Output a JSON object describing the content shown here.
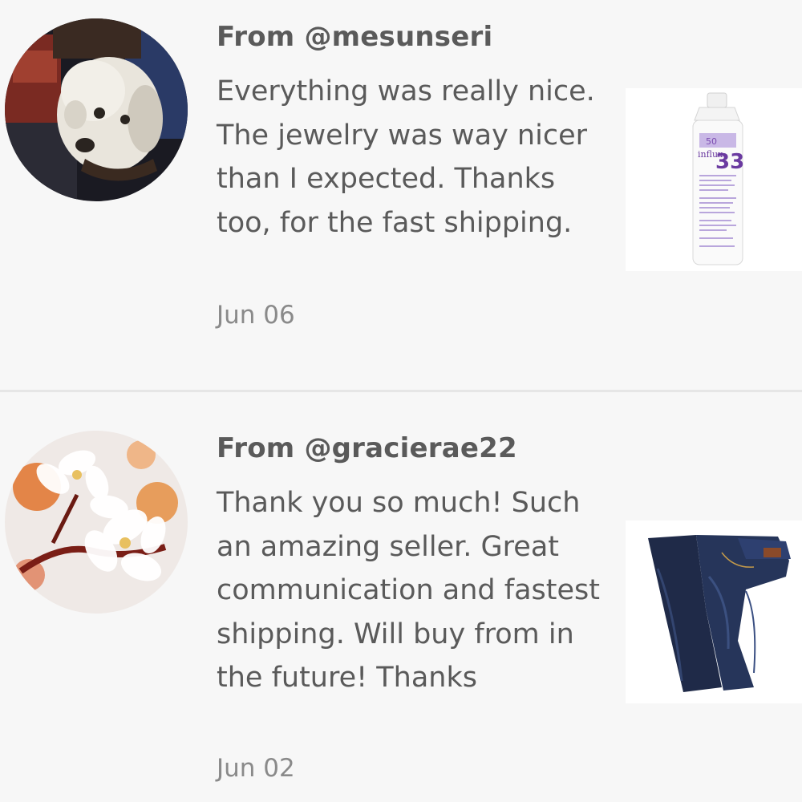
{
  "reviews": [
    {
      "from": "From @mesunseri",
      "comment": "Everything was really nice. The jewelry was way nicer than I expected. Thanks too, for the fast shipping.",
      "date": "Jun 06",
      "avatar_icon": "dog-photo",
      "product_icon": "conditioner-bottle-photo",
      "product_label": {
        "badge": "50",
        "brand": "influx",
        "number": "33"
      }
    },
    {
      "from": "From @gracierae22",
      "comment": "Thank you so much! Such an amazing seller. Great communication and fastest shipping. Will buy from in the future! Thanks",
      "date": "Jun 02",
      "avatar_icon": "cherry-blossom-photo",
      "product_icon": "jeans-photo"
    }
  ],
  "colors": {
    "background": "#f7f7f7",
    "text": "#5a5a5a",
    "date_text": "#8a8a8a",
    "divider": "#e6e6e6"
  }
}
